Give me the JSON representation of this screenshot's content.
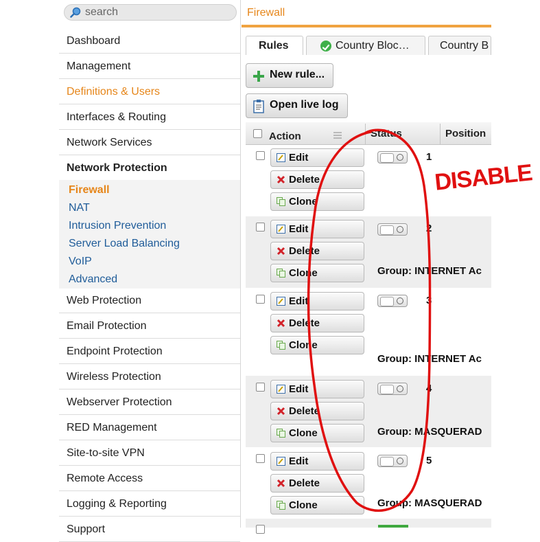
{
  "search": {
    "placeholder": "search"
  },
  "sidebar": {
    "items": [
      {
        "label": "Dashboard"
      },
      {
        "label": "Management"
      },
      {
        "label": "Definitions & Users"
      },
      {
        "label": "Interfaces & Routing"
      },
      {
        "label": "Network Services"
      },
      {
        "label": "Network Protection"
      }
    ],
    "subitems": [
      {
        "label": "Firewall"
      },
      {
        "label": "NAT"
      },
      {
        "label": "Intrusion Prevention"
      },
      {
        "label": "Server Load Balancing"
      },
      {
        "label": "VoIP"
      },
      {
        "label": "Advanced"
      }
    ],
    "items_after": [
      {
        "label": "Web Protection"
      },
      {
        "label": "Email Protection"
      },
      {
        "label": "Endpoint Protection"
      },
      {
        "label": "Wireless Protection"
      },
      {
        "label": "Webserver Protection"
      },
      {
        "label": "RED Management"
      },
      {
        "label": "Site-to-site VPN"
      },
      {
        "label": "Remote Access"
      },
      {
        "label": "Logging & Reporting"
      },
      {
        "label": "Support"
      }
    ]
  },
  "main": {
    "title": "Firewall",
    "tabs": [
      {
        "label": "Rules"
      },
      {
        "label": "Country Bloc…"
      },
      {
        "label": "Country B"
      }
    ],
    "new_rule_label": "New rule...",
    "live_log_label": "Open live log",
    "columns": {
      "action": "Action",
      "status": "Status",
      "position": "Position"
    },
    "row_buttons": {
      "edit": "Edit",
      "delete": "Delete",
      "clone": "Clone"
    },
    "rows": [
      {
        "position": "1",
        "group": ""
      },
      {
        "position": "2",
        "group": "Group: INTERNET Ac"
      },
      {
        "position": "3",
        "group": "Group: INTERNET Ac"
      },
      {
        "position": "4",
        "group": "Group: MASQUERAD"
      },
      {
        "position": "5",
        "group": "Group: MASQUERAD"
      }
    ]
  },
  "annotation": {
    "text": "DISABLE"
  },
  "colors": {
    "accent": "#e6861a",
    "link": "#1f5c99",
    "annotation": "#e01010"
  }
}
